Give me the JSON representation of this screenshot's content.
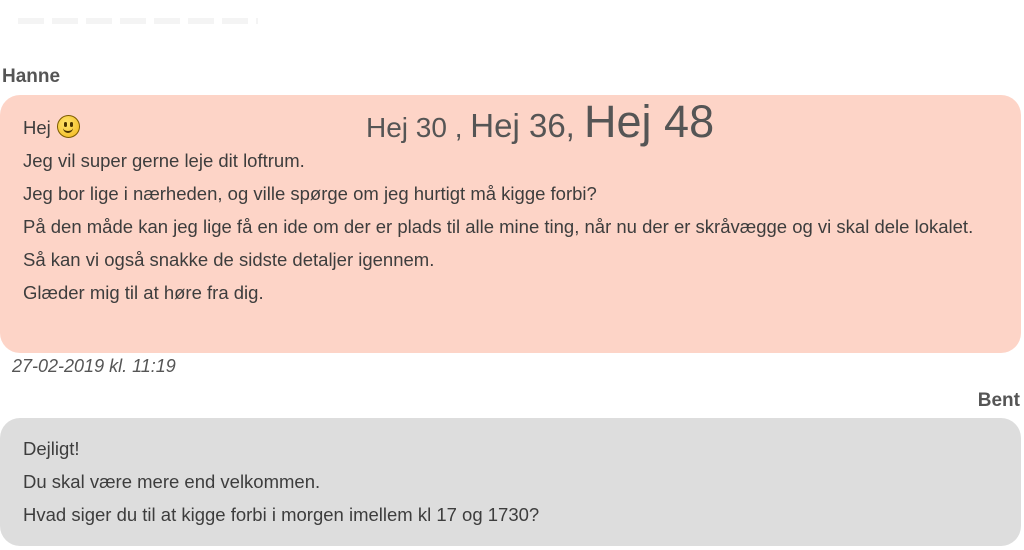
{
  "thread": {
    "messages": [
      {
        "sender": "Hanne",
        "lines": [
          "Hej",
          "Jeg vil super gerne leje dit loftrum.",
          "Jeg bor lige i nærheden, og ville spørge om jeg hurtigt må kigge forbi?",
          "På den måde kan jeg lige få en ide om der er plads til alle mine ting, når nu der er skråvægge og vi skal dele lokalet.",
          "Så kan vi også snakke de sidste detaljer igennem.",
          "Glæder mig til at høre fra dig."
        ],
        "timestamp": "27-02-2019 kl. 11:19",
        "bubble_color": "#fdd4c7"
      },
      {
        "sender": "Bent",
        "lines": [
          "Dejligt!",
          "Du skal være mere end velkommen.",
          "Hvad siger du til at kigge forbi i morgen imellem kl 17 og 1730?"
        ],
        "bubble_color": "#dddddd"
      }
    ]
  },
  "overlay": {
    "part1": "Hej 30",
    "sep1": " , ",
    "part2": "Hej 36",
    "sep2": ", ",
    "part3": "Hej 48"
  },
  "icons": {
    "emoji": "smiley-face-icon"
  }
}
